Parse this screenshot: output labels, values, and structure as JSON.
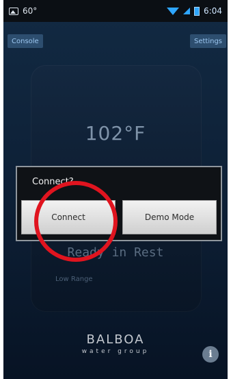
{
  "status_bar": {
    "signal_text": "60°",
    "time": "6:04"
  },
  "header": {
    "left_button": "Console",
    "right_button": "Settings"
  },
  "main": {
    "temperature": "102°F",
    "status": "Ready in Rest",
    "range": "Low Range"
  },
  "dialog": {
    "title": "Connect?",
    "connect_label": "Connect",
    "demo_label": "Demo Mode"
  },
  "footer": {
    "brand": "BALBOA",
    "sub": "water group",
    "info_label": "i"
  },
  "colors": {
    "highlight_circle": "#e0141f",
    "status_blue": "#2ea6ff"
  },
  "icons": [
    "image-icon",
    "wifi-icon",
    "signal-icon",
    "battery-icon",
    "info-icon"
  ]
}
